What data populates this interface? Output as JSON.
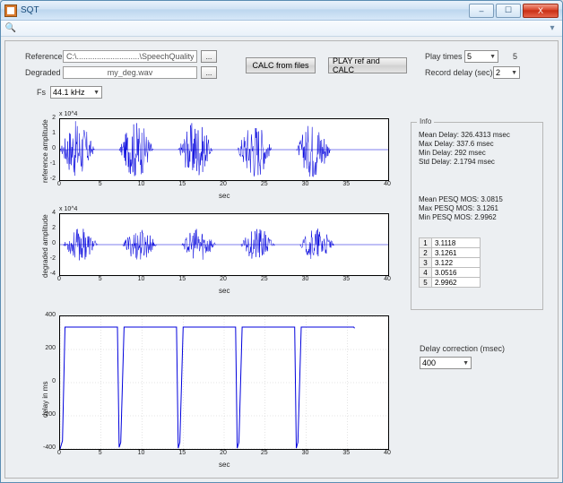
{
  "window": {
    "title": "SQT"
  },
  "titlebar": {
    "min": "–",
    "max": "☐",
    "close": "X"
  },
  "toolbar": {
    "zoom": "🔍",
    "menu": "▾"
  },
  "labels": {
    "reference": "Reference",
    "degraded": "Degraded",
    "fs": "Fs",
    "play_times": "Play times",
    "record_delay": "Record delay (sec)",
    "delay_correction": "Delay correction (msec)",
    "info": "Info",
    "sec": "sec"
  },
  "inputs": {
    "reference_path": "C:\\............................\\SpeechQualityTest_GUI\\my_ref.",
    "degraded_path": "my_deg.wav",
    "fs_value": "44.1 kHz",
    "play_times_value": "5",
    "play_count_display": "5",
    "record_delay_value": "2",
    "delay_correction_value": "400",
    "browse": "..."
  },
  "buttons": {
    "calc_from_files": "CALC from files",
    "play_ref_and_calc": "PLAY ref and CALC"
  },
  "info": {
    "mean_delay": "Mean Delay: 326.4313 msec",
    "max_delay": "Max Delay: 337.6 msec",
    "min_delay": "Min Delay: 292 msec",
    "std_delay": "Std Delay: 2.1794 msec",
    "mean_pesq": "Mean PESQ MOS: 3.0815",
    "max_pesq": "Max PESQ MOS: 3.1261",
    "min_pesq": "Min PESQ MOS: 2.9962",
    "rows": [
      {
        "n": "1",
        "v": "3.1118"
      },
      {
        "n": "2",
        "v": "3.1261"
      },
      {
        "n": "3",
        "v": "3.122"
      },
      {
        "n": "4",
        "v": "3.0516"
      },
      {
        "n": "5",
        "v": "2.9962"
      }
    ]
  },
  "chart_data": [
    {
      "type": "line",
      "title": "",
      "xlabel": "sec",
      "ylabel": "reference amplitude",
      "ylim": [
        -2,
        2
      ],
      "xlim": [
        0,
        40
      ],
      "y_multiplier_label": "x 10^4",
      "xticks": [
        0,
        5,
        10,
        15,
        20,
        25,
        30,
        35,
        40
      ],
      "yticks": [
        -2,
        -1,
        0,
        1,
        2
      ],
      "bursts_sec": [
        [
          0,
          4.2
        ],
        [
          7.2,
          11.4
        ],
        [
          14.4,
          18.6
        ],
        [
          21.6,
          25.8
        ],
        [
          28.8,
          33
        ]
      ],
      "amplitude_peak": 1.9
    },
    {
      "type": "line",
      "title": "",
      "xlabel": "sec",
      "ylabel": "degraded amplitude",
      "ylim": [
        -4,
        4
      ],
      "xlim": [
        0,
        40
      ],
      "y_multiplier_label": "x 10^4",
      "xticks": [
        0,
        5,
        10,
        15,
        20,
        25,
        30,
        35,
        40
      ],
      "yticks": [
        -4,
        -2,
        0,
        2,
        4
      ],
      "bursts_sec": [
        [
          0.4,
          4.6
        ],
        [
          7.6,
          11.8
        ],
        [
          14.8,
          19
        ],
        [
          22,
          26.2
        ],
        [
          29.2,
          33.4
        ]
      ],
      "amplitude_peak": 2.2
    },
    {
      "type": "line",
      "title": "",
      "xlabel": "sec",
      "ylabel": "delay in ms",
      "ylim": [
        -400,
        400
      ],
      "xlim": [
        0,
        40
      ],
      "xticks": [
        0,
        5,
        10,
        15,
        20,
        25,
        30,
        35,
        40
      ],
      "yticks": [
        -400,
        -200,
        0,
        200,
        400
      ],
      "series": [
        {
          "name": "delay",
          "x": [
            0,
            0.3,
            0.6,
            7.0,
            7.2,
            7.4,
            7.8,
            14.2,
            14.4,
            14.6,
            15.0,
            21.4,
            21.6,
            21.8,
            22.2,
            28.6,
            28.8,
            29.0,
            29.4,
            35.8,
            35.9
          ],
          "values": [
            -400,
            -350,
            335,
            335,
            -390,
            -360,
            335,
            335,
            -395,
            -360,
            335,
            335,
            -395,
            -360,
            335,
            335,
            -395,
            -360,
            335,
            335,
            328
          ]
        }
      ]
    }
  ]
}
